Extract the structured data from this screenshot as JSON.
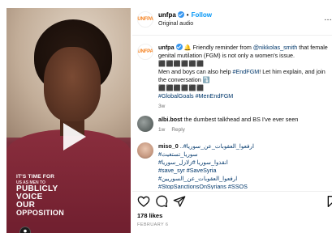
{
  "post": {
    "username": "unfpa",
    "follow_label": "Follow",
    "audio": "Original audio",
    "more_label": "…",
    "logo_text": "UNFPA",
    "video_overlay": {
      "line1": "IT'S TIME FOR",
      "line2": "US AS MEN TO",
      "line3": "PUBLICLY",
      "line4": "VOICE",
      "line5": "OUR",
      "line6": "OPPOSITION"
    }
  },
  "caption": {
    "username": "unfpa",
    "text1": "🔔 Friendly reminder from ",
    "mention": "@nikkolas_smith",
    "text2": " that female genital mutilation (FGM) is not only a women's issue.",
    "placeholder_line1": "⬛⬛⬛⬛⬛⬛",
    "text3": "Men and boys can also help ",
    "hashtag1": "#EndFGM",
    "text4": "! Let him explain, and join the conversation ⤵️",
    "placeholder_line2": "⬛⬛⬛⬛⬛⬛",
    "hashtag2": "#GlobalGoals",
    "hashtag3": "#MenEndFGM",
    "time": "3w"
  },
  "comments": [
    {
      "username": "albi.bost",
      "text": "the dumbest talkhead and BS I've ever seen",
      "time": "1w",
      "reply_label": "Reply"
    },
    {
      "username": "miso_0",
      "text": "..#ارفعوا_العقوبات_عن_سوريا",
      "line2": "#سوريا_تستغيث",
      "line3": "#انقذوا_سوريا #زلازل_سوريا",
      "line4": "#save_syr #SaveSyria",
      "line5": "#ارفعوا_العقوبات_عن_السوريين",
      "line6": "#StopSanctionsOnSyrians #SSOS"
    }
  ],
  "stats": {
    "likes": "178 likes",
    "date": "FEBRUARY 6"
  },
  "colors": {
    "accent": "#0095f6",
    "verified": "#3897f0",
    "hashtag": "#00376b",
    "meta": "#737373",
    "shirt": "#7a2f3c"
  },
  "icons": {
    "like": "heart-icon",
    "comment": "comment-icon",
    "share": "send-icon",
    "save": "bookmark-icon",
    "user": "user-icon"
  }
}
